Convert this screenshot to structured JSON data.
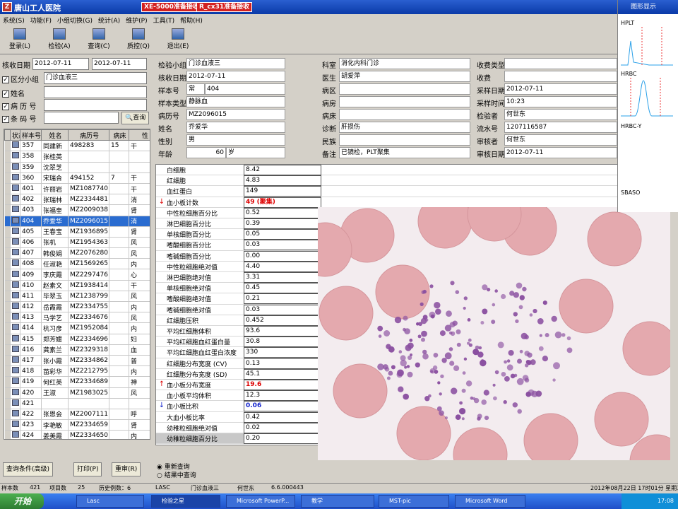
{
  "window": {
    "title": "唐山工人医院",
    "alerts": [
      "XE-5000准备接收",
      "R_cx31准备接收"
    ],
    "menu": [
      "系统(S)",
      "功能(F)",
      "小组切换(G)",
      "统计(A)",
      "维护(P)",
      "工具(T)",
      "帮助(H)"
    ]
  },
  "toolbar": [
    {
      "label": "登录(L)",
      "icon": "login-icon"
    },
    {
      "label": "检验(A)",
      "icon": "test-icon"
    },
    {
      "label": "查询(C)",
      "icon": "query-icon"
    },
    {
      "label": "质控(Q)",
      "icon": "qc-icon"
    },
    {
      "label": "退出(E)",
      "icon": "exit-icon"
    }
  ],
  "filters": {
    "date_label": "核收日期",
    "date_from": "2012-07-11",
    "date_to": "2012-07-11",
    "group_label": "区分小组",
    "group_value": "门诊血液三",
    "name_label": "姓名",
    "record_label": "病 历 号",
    "barcode_label": "条 码 号",
    "query_btn": "查询"
  },
  "grid": {
    "headers": [
      "状态",
      "样本号",
      "姓名",
      "病历号",
      "病床",
      "性"
    ],
    "rows": [
      [
        "357",
        "同建新",
        "498283",
        "15",
        "干"
      ],
      [
        "358",
        "张桂英",
        "",
        "",
        ""
      ],
      [
        "359",
        "沈翠芝",
        "",
        "",
        ""
      ],
      [
        "360",
        "宋瑞合",
        "494152",
        "7",
        "干"
      ],
      [
        "401",
        "许丽岩",
        "MZ1087740",
        "",
        "干"
      ],
      [
        "402",
        "张瑞林",
        "MZ2334481",
        "",
        "消"
      ],
      [
        "403",
        "张福奎",
        "MZ2009038",
        "",
        "肾"
      ],
      [
        "404",
        "乔爱华",
        "MZ2096015",
        "",
        "消"
      ],
      [
        "405",
        "王春宝",
        "MZ1936895",
        "",
        "肾"
      ],
      [
        "406",
        "张机",
        "MZ1954363",
        "",
        "风"
      ],
      [
        "407",
        "韩俊娟",
        "MZ2076280",
        "",
        "风"
      ],
      [
        "408",
        "任淑艳",
        "MZ1569265",
        "",
        "内"
      ],
      [
        "409",
        "李庆霞",
        "MZ2297476",
        "",
        "心"
      ],
      [
        "410",
        "赵素文",
        "MZ1938414",
        "",
        "干"
      ],
      [
        "411",
        "毕翠玉",
        "MZ1238799",
        "",
        "风"
      ],
      [
        "412",
        "岳霞霞",
        "MZ2334755",
        "",
        "内"
      ],
      [
        "413",
        "马学艺",
        "MZ2334676",
        "",
        "风"
      ],
      [
        "414",
        "杭习彦",
        "MZ1952084",
        "",
        "内"
      ],
      [
        "415",
        "郑芳媛",
        "MZ2334696",
        "",
        "妇"
      ],
      [
        "416",
        "龚素兰",
        "MZ2329318",
        "",
        "血"
      ],
      [
        "417",
        "张小霞",
        "MZ2334862",
        "",
        "普"
      ],
      [
        "418",
        "苗彩华",
        "MZ2212795",
        "",
        "内"
      ],
      [
        "419",
        "何红英",
        "MZ2334689",
        "",
        "神"
      ],
      [
        "420",
        "王淑",
        "MZ1983025",
        "",
        "风"
      ],
      [
        "421",
        "",
        "",
        "",
        ""
      ],
      [
        "422",
        "张恩会",
        "MZ2007111",
        "",
        "呼"
      ],
      [
        "423",
        "李艳敏",
        "MZ2334659",
        "",
        "肾"
      ],
      [
        "424",
        "姜美霞",
        "MZ2334650",
        "",
        "内"
      ]
    ],
    "selected_index": 7
  },
  "patient": {
    "col1": [
      {
        "l": "检验小组",
        "v": "门诊血液三"
      },
      {
        "l": "核收日期",
        "v": "2012-07-11"
      },
      {
        "l": "样本号",
        "v": "常",
        "v2": "404"
      },
      {
        "l": "样本类型",
        "v": "静脉血"
      },
      {
        "l": "病历号",
        "v": "MZ2096015"
      },
      {
        "l": "姓名",
        "v": "乔爱华"
      },
      {
        "l": "性别",
        "v": "男"
      },
      {
        "l": "年龄",
        "v": "60",
        "v2": "岁"
      }
    ],
    "col2": [
      {
        "l": "科室",
        "v": "消化内科门诊"
      },
      {
        "l": "医生",
        "v": "胡爱萍"
      },
      {
        "l": "病区",
        "v": ""
      },
      {
        "l": "病房",
        "v": ""
      },
      {
        "l": "病床",
        "v": ""
      },
      {
        "l": "诊断",
        "v": "肝损伤"
      },
      {
        "l": "民族",
        "v": ""
      },
      {
        "l": "备注",
        "v": "已镜检，PLT聚集"
      }
    ],
    "col3": [
      {
        "l": "收费类型",
        "v": ""
      },
      {
        "l": "收费",
        "v": ""
      },
      {
        "l": "采样日期",
        "v": "2012-07-11"
      },
      {
        "l": "采样时间",
        "v": "10:23"
      },
      {
        "l": "检验者",
        "v": "何世东"
      },
      {
        "l": "流水号",
        "v": "1207116587"
      },
      {
        "l": "审核者",
        "v": "何世东"
      },
      {
        "l": "审核日期",
        "v": "2012-07-11"
      }
    ]
  },
  "results": [
    {
      "n": "白细胞",
      "v": "8.42",
      "f": "",
      "c": ""
    },
    {
      "n": "红细胞",
      "v": "4.83",
      "f": "",
      "c": ""
    },
    {
      "n": "血红蛋白",
      "v": "149",
      "f": "",
      "c": ""
    },
    {
      "n": "血小板计数",
      "v": "49 (聚集)",
      "f": "↓",
      "c": "red"
    },
    {
      "n": "中性粒细胞百分比",
      "v": "0.52",
      "f": "",
      "c": ""
    },
    {
      "n": "淋巴细胞百分比",
      "v": "0.39",
      "f": "",
      "c": ""
    },
    {
      "n": "单核细胞百分比",
      "v": "0.05",
      "f": "",
      "c": ""
    },
    {
      "n": "嗜酸细胞百分比",
      "v": "0.03",
      "f": "",
      "c": ""
    },
    {
      "n": "嗜碱细胞百分比",
      "v": "0.00",
      "f": "",
      "c": ""
    },
    {
      "n": "中性粒细胞绝对值",
      "v": "4.40",
      "f": "",
      "c": ""
    },
    {
      "n": "淋巴细胞绝对值",
      "v": "3.31",
      "f": "",
      "c": ""
    },
    {
      "n": "单核细胞绝对值",
      "v": "0.45",
      "f": "",
      "c": ""
    },
    {
      "n": "嗜酸细胞绝对值",
      "v": "0.21",
      "f": "",
      "c": ""
    },
    {
      "n": "嗜碱细胞绝对值",
      "v": "0.03",
      "f": "",
      "c": ""
    },
    {
      "n": "红细胞压积",
      "v": "0.452",
      "f": "",
      "c": ""
    },
    {
      "n": "平均红细胞体积",
      "v": "93.6",
      "f": "",
      "c": ""
    },
    {
      "n": "平均红细胞血红蛋白量",
      "v": "30.8",
      "f": "",
      "c": ""
    },
    {
      "n": "平均红细胞血红蛋白浓度",
      "v": "330",
      "f": "",
      "c": ""
    },
    {
      "n": "红细胞分布宽度 (CV)",
      "v": "0.13",
      "f": "",
      "c": ""
    },
    {
      "n": "红细胞分布宽度 (SD)",
      "v": "45.1",
      "f": "",
      "c": ""
    },
    {
      "n": "血小板分布宽度",
      "v": "19.6",
      "f": "↑",
      "c": "red"
    },
    {
      "n": "血小板平均体积",
      "v": "12.3",
      "f": "",
      "c": ""
    },
    {
      "n": "血小板比积",
      "v": "0.06",
      "f": "↓",
      "c": "blue"
    },
    {
      "n": "大血小板比率",
      "v": "0.42",
      "f": "",
      "c": ""
    },
    {
      "n": "幼稚粒细胞绝对值",
      "v": "0.02",
      "f": "",
      "c": ""
    },
    {
      "n": "幼稚粒细胞百分比",
      "v": "0.20",
      "f": "",
      "c": ""
    }
  ],
  "right_panel": {
    "title": "图形显示",
    "labels": [
      "HPLT",
      "HRBC",
      "HRBC-Y",
      "SBASO"
    ]
  },
  "bottom": {
    "btn_query_adv": "查询条件(高级)",
    "btn_print": "打印(P)",
    "btn_redo": "重审(R)",
    "radio1": "重新查询",
    "radio2": "结果中查询"
  },
  "status": {
    "sample_count_label": "样本数",
    "sample_count": "421",
    "item_count_label": "项目数",
    "item_count": "25",
    "history_label": "历史例数：6",
    "lasc": "LASC",
    "group": "门诊血液三",
    "user": "何世东",
    "version": "6.6.000443",
    "datetime": "2012年08月22日 17时01分 星期三"
  },
  "taskbar": {
    "start": "开始",
    "tasks": [
      "Lasc",
      "检验之星",
      "Microsoft PowerP...",
      "教学",
      "MST-pic",
      "Microsoft Word"
    ],
    "clock": "17:08"
  }
}
